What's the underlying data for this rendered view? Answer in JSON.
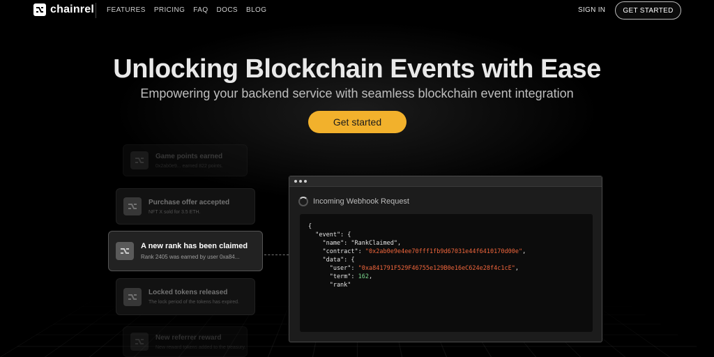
{
  "nav": {
    "logo_text": "chainrel",
    "links": [
      "FEATURES",
      "PRICING",
      "FAQ",
      "DOCS",
      "BLOG"
    ],
    "sign_in": "SIGN IN",
    "get_started": "GET STARTED"
  },
  "hero": {
    "title": "Unlocking Blockchain Events with Ease",
    "subtitle": "Empowering your backend service with seamless blockchain event integration",
    "cta": "Get started"
  },
  "events": [
    {
      "title": "Game points earned",
      "desc": "0x2ab0e9... earned 822 points."
    },
    {
      "title": "Purchase offer accepted",
      "desc": "NFT X sold for 3.5 ETH."
    },
    {
      "title": "A new rank has been claimed",
      "desc": "Rank 2405 was earned by user 0xa84..."
    },
    {
      "title": "Locked tokens released",
      "desc": "The lock period of the tokens has expired."
    },
    {
      "title": "New referrer reward",
      "desc": "New reward tokens added to the treasury."
    }
  ],
  "webhook": {
    "header": "Incoming Webhook Request",
    "event_name": "RankClaimed",
    "contract": "0x2ab0e9e4ee70fff1fb9d67031e44f6410170d00e",
    "user": "0xa841791F529F46755e129B0e16eC624e28f4c1cE",
    "term": "162"
  },
  "colors": {
    "accent": "#f2b12c",
    "string": "#f0663c",
    "number": "#7bd88f",
    "background": "#000000"
  }
}
